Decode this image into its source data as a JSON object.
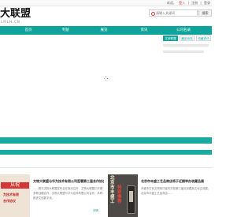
{
  "topbar": {
    "links": [
      "欢迎，",
      "登入",
      "|",
      "注册",
      "|",
      "登录"
    ]
  },
  "logo": {
    "cn": "大联盟",
    "en": "LMLH.CN"
  },
  "search": {
    "placeholder": "请输入关键词",
    "button": "搜索"
  },
  "nav": {
    "items": [
      "首页",
      "专题",
      "展览",
      "资讯",
      "公司名录"
    ]
  },
  "side_panel": {
    "tabs": [
      "文体联盟",
      "藏品动态",
      "收藏资讯"
    ]
  },
  "cards": [
    {
      "title": "文物大联盟与华为技术有限公司签署第三届合作协议",
      "body": "……首次文物大联盟发布会在南京召开，文物大联盟已开展多种战略合作，文物大联盟与华为技术有限公司合作，共同推进文化数字化。",
      "more": "详情",
      "thumb": {
        "line1": "从祝",
        "line2": "为技术有限",
        "line3": "合作协议"
      },
      "accent": "#d2282a"
    },
    {
      "title": "北京市丰盛工艺品商店将于近期举办收藏品展",
      "body": "丰盛市古玩文物商厅宣布开放第三届北京藏品文化交流展，北京市丰盛工艺品商店……",
      "more": "详情",
      "thumb": {
        "col1": "北京市丰盛工",
        "col2": "特别推荐"
      },
      "accent": "#4d4a47"
    }
  ],
  "colors": {
    "brand_teal": "#0fa49b",
    "strip_teal": "#19aaa2",
    "register_red": "#d6372d"
  },
  "icons": {
    "search": "search-icon",
    "loading": "loading-spinner-icon"
  }
}
